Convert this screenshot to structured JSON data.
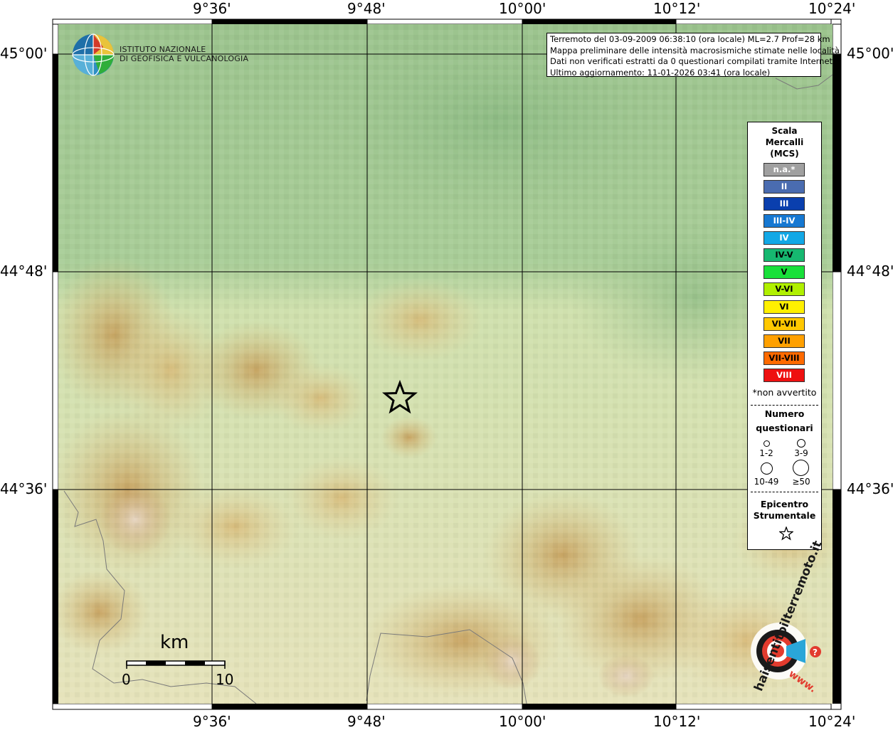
{
  "map": {
    "top_ticks": [
      "9°36'",
      "9°48'",
      "10°00'",
      "10°12'",
      "10°24'"
    ],
    "bottom_ticks": [
      "9°36'",
      "9°48'",
      "10°00'",
      "10°12'",
      "10°24'"
    ],
    "left_ticks": [
      "45°00'",
      "44°48'",
      "44°36'"
    ],
    "right_ticks": [
      "45°00'",
      "44°48'",
      "44°36'"
    ]
  },
  "logo": {
    "line1": "ISTITUTO NAZIONALE",
    "line2": "DI GEOFISICA E VULCANOLOGIA"
  },
  "info": {
    "line1": "Terremoto del 03-09-2009 06:38:10 (ora locale) ML=2.7 Prof=28 km",
    "line2": "Mappa preliminare delle intensità macrosismiche stimate nelle località",
    "line3": "Dati non verificati estratti da 0 questionari compilati tramite Internet.",
    "line4": "Ultimo aggiornamento: 11-01-2026 03:41 (ora locale)"
  },
  "legend": {
    "title1": "Scala",
    "title2": "Mercalli",
    "title3": "(MCS)",
    "classes": [
      {
        "label": "n.a.*",
        "color": "#a0a0a0"
      },
      {
        "label": "II",
        "color": "#4a6cb0"
      },
      {
        "label": "III",
        "color": "#0a3fae"
      },
      {
        "label": "III-IV",
        "color": "#1678d2"
      },
      {
        "label": "IV",
        "color": "#12a8e6"
      },
      {
        "label": "IV-V",
        "color": "#16b870"
      },
      {
        "label": "V",
        "color": "#18e03a"
      },
      {
        "label": "V-VI",
        "color": "#b0f000"
      },
      {
        "label": "VI",
        "color": "#fff000"
      },
      {
        "label": "VI-VII",
        "color": "#ffc800"
      },
      {
        "label": "VII",
        "color": "#ffa000"
      },
      {
        "label": "VII-VIII",
        "color": "#ff6a00"
      },
      {
        "label": "VIII",
        "color": "#ee1010"
      }
    ],
    "na_note": "*non avvertito",
    "count_title1": "Numero",
    "count_title2": "questionari",
    "count_labels": [
      "1-2",
      "3-9",
      "10-49",
      "≥50"
    ],
    "epi_title1": "Epicentro",
    "epi_title2": "Strumentale"
  },
  "scalebar": {
    "unit": "km",
    "start": "0",
    "end": "10"
  },
  "watermark": {
    "text": "haisentitoilterremoto.it",
    "url": "www."
  },
  "colors": {
    "intensity_dark_text": "#000000"
  }
}
